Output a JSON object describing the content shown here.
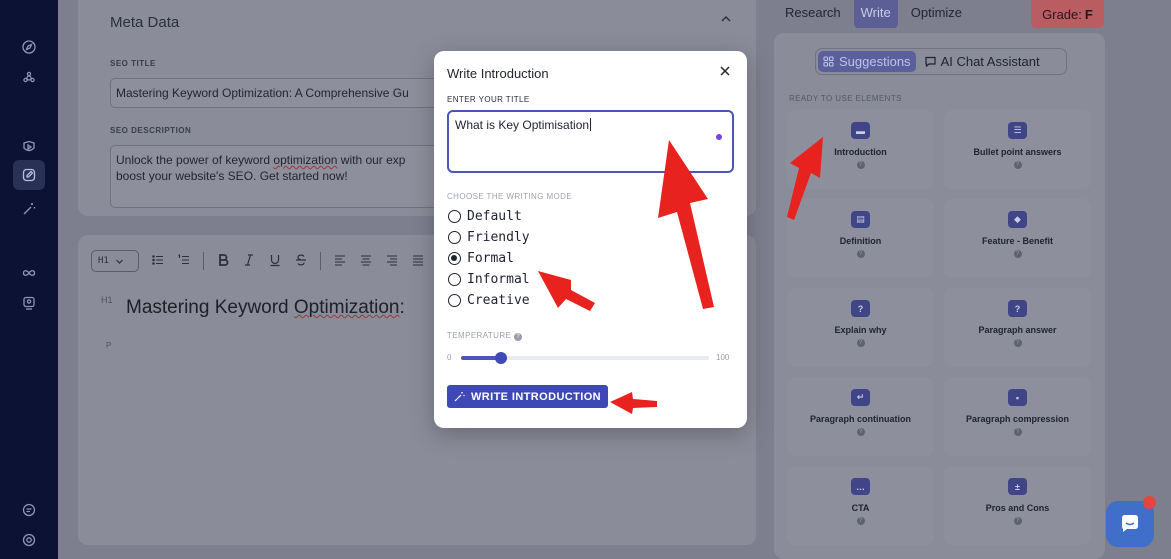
{
  "rail": {
    "icons": [
      "compass-icon",
      "gear-flower-icon",
      "shield-play-icon",
      "edit-icon",
      "magic-wand-icon",
      "infinity-icon",
      "monitor-icon",
      "chat-icon",
      "help-circle-icon"
    ]
  },
  "meta": {
    "title": "Meta Data",
    "seo_title_label": "SEO TITLE",
    "seo_title_value": "Mastering Keyword Optimization: A Comprehensive Gu",
    "seo_description_label": "SEO DESCRIPTION",
    "seo_description_value_line1_a": "Unlock the power of keyword ",
    "seo_description_value_line1_b": "optimization",
    "seo_description_value_line1_c": " with our exp",
    "seo_description_value_line2": "boost your website's SEO. Get started now!"
  },
  "editor": {
    "heading_select": "H1",
    "h1_tag": "H1",
    "h1_text_a": "Mastering Keyword ",
    "h1_text_b": "Optimization",
    "h1_text_c": ":",
    "p_tag": "P"
  },
  "tabs": {
    "research": "Research",
    "write": "Write",
    "optimize": "Optimize",
    "grade_label": "Grade:",
    "grade_value": "F"
  },
  "panel": {
    "suggestions": "Suggestions",
    "ai_chat": "AI Chat Assistant",
    "section_label": "READY TO USE ELEMENTS",
    "tiles": [
      {
        "label": "Introduction",
        "icon": "▬"
      },
      {
        "label": "Bullet point answers",
        "icon": "☰"
      },
      {
        "label": "Definition",
        "icon": "▤"
      },
      {
        "label": "Feature - Benefit",
        "icon": "◆"
      },
      {
        "label": "Explain why",
        "icon": "?"
      },
      {
        "label": "Paragraph answer",
        "icon": "?"
      },
      {
        "label": "Paragraph continuation",
        "icon": "↵"
      },
      {
        "label": "Paragraph compression",
        "icon": "▪"
      },
      {
        "label": "CTA",
        "icon": "…"
      },
      {
        "label": "Pros and Cons",
        "icon": "±"
      }
    ]
  },
  "modal": {
    "title": "Write Introduction",
    "title_label": "ENTER YOUR TITLE",
    "title_value": "What is Key Optimisation",
    "mode_label": "CHOOSE THE WRITING MODE",
    "modes": [
      "Default",
      "Friendly",
      "Formal",
      "Informal",
      "Creative"
    ],
    "selected_mode": "Formal",
    "temperature_label": "TEMPERATURE",
    "temperature_min": "0",
    "temperature_max": "100",
    "temperature_value": 16,
    "button_label": "WRITE INTRODUCTION"
  },
  "colors": {
    "accent": "#3e49b5",
    "rail": "#0b1233",
    "grade": "#b95d63",
    "arrow": "#e8221e"
  }
}
